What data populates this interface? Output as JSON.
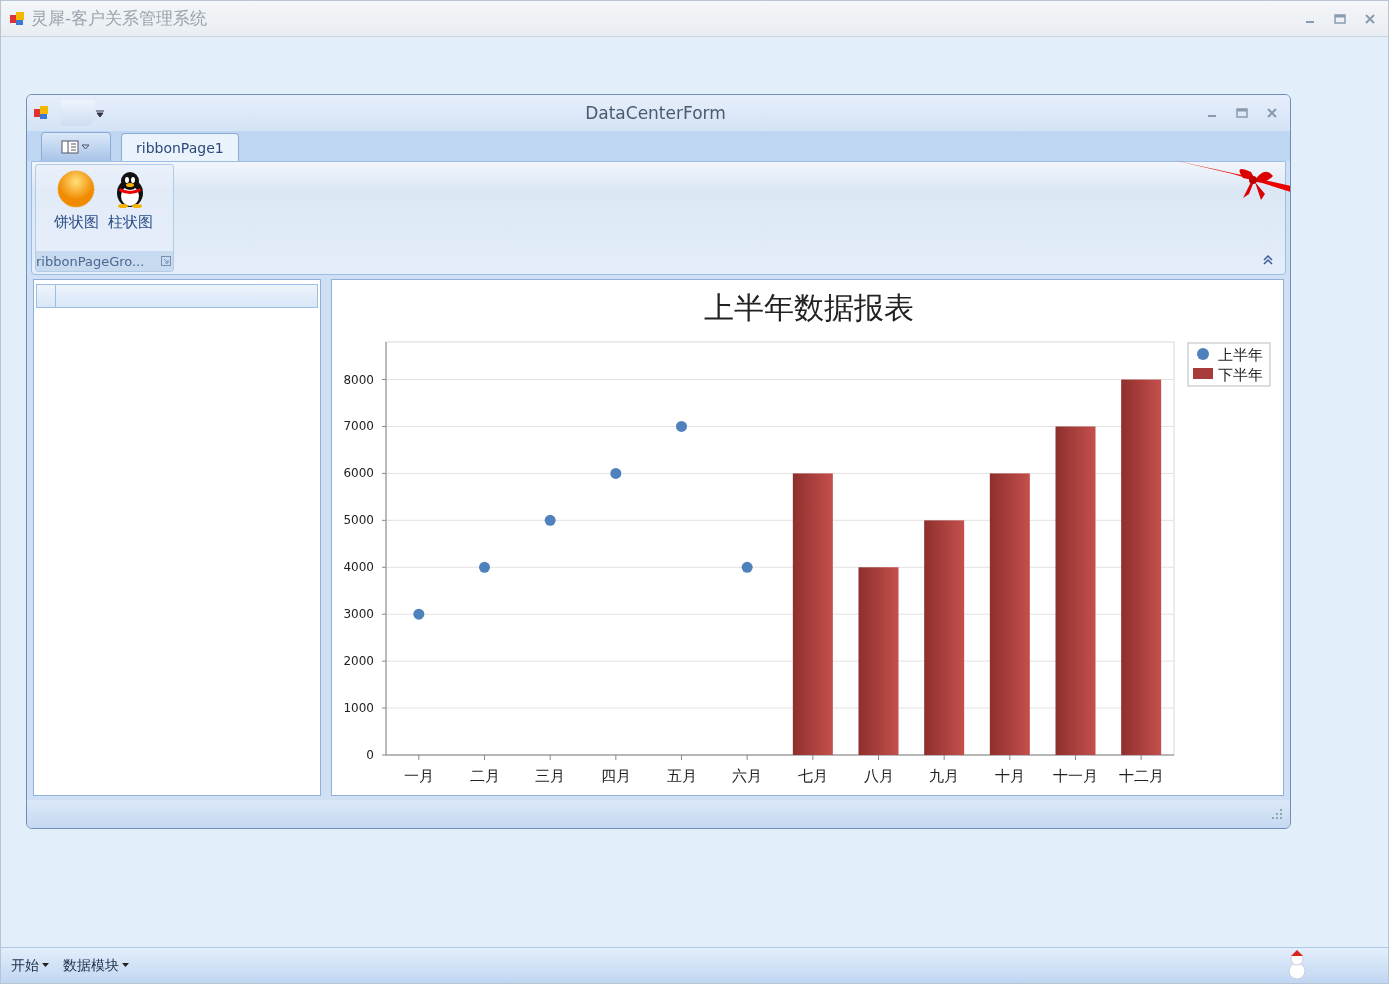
{
  "window": {
    "title": "灵犀-客户关系管理系统"
  },
  "form": {
    "title": "DataCenterForm",
    "tabs": [
      {
        "label": "ribbonPage1",
        "selected": true
      }
    ],
    "ribbon_group": {
      "caption": "ribbonPageGro...",
      "buttons": [
        {
          "label": "饼状图",
          "kind": "sun"
        },
        {
          "label": "柱状图",
          "kind": "penguin"
        }
      ]
    },
    "chart_data": {
      "type": "bar",
      "title": "上半年数据报表",
      "categories": [
        "一月",
        "二月",
        "三月",
        "四月",
        "五月",
        "六月",
        "七月",
        "八月",
        "九月",
        "十月",
        "十一月",
        "十二月"
      ],
      "series": [
        {
          "name": "上半年",
          "type": "scatter",
          "color": "#4f81bd",
          "values": [
            3000,
            4000,
            5000,
            6000,
            7000,
            4000,
            null,
            null,
            null,
            null,
            null,
            null
          ]
        },
        {
          "name": "下半年",
          "type": "bar",
          "color": "#a83c3a",
          "values": [
            null,
            null,
            null,
            null,
            null,
            null,
            6000,
            4000,
            5000,
            6000,
            7000,
            8000
          ]
        }
      ],
      "grid": true,
      "legend": true,
      "ylim": [
        0,
        8800
      ],
      "yticks": [
        0,
        1000,
        2000,
        3000,
        4000,
        5000,
        6000,
        7000,
        8000
      ]
    }
  },
  "taskbar": {
    "items": [
      "开始",
      "数据模块"
    ]
  }
}
